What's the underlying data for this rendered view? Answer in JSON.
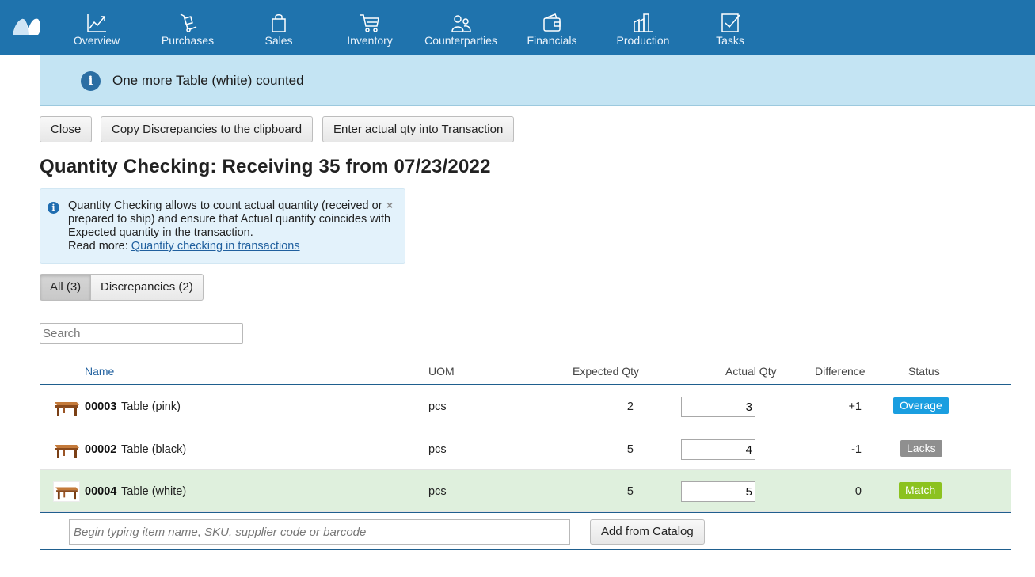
{
  "nav": {
    "items": [
      {
        "label": "Overview",
        "icon": "chart-line-icon"
      },
      {
        "label": "Purchases",
        "icon": "cart-dolly-icon"
      },
      {
        "label": "Sales",
        "icon": "shopping-bag-icon"
      },
      {
        "label": "Inventory",
        "icon": "cart-icon"
      },
      {
        "label": "Counterparties",
        "icon": "people-icon"
      },
      {
        "label": "Financials",
        "icon": "wallet-icon"
      },
      {
        "label": "Production",
        "icon": "factory-icon"
      },
      {
        "label": "Tasks",
        "icon": "checkbox-icon"
      }
    ],
    "background": "#1f73ad"
  },
  "notification": {
    "message": "One more Table (white) counted",
    "icon": "i",
    "background": "#c4e4f3"
  },
  "actions": {
    "close": "Close",
    "copy": "Copy Discrepancies to the clipboard",
    "enter": "Enter actual qty into Transaction"
  },
  "page_title": "Quantity Checking: Receiving 35 from 07/23/2022",
  "info": {
    "icon": "i",
    "text": "Quantity Checking allows to count actual quantity (received or prepared to ship) and ensure that Actual quantity coincides with Expected quantity in the transaction.",
    "read_more": "Read more:",
    "link": "Quantity checking in transactions",
    "close": "×"
  },
  "filters": {
    "all": "All (3)",
    "discrepancies": "Discrepancies (2)"
  },
  "search": {
    "placeholder": "Search"
  },
  "table": {
    "headers": {
      "name": "Name",
      "uom": "UOM",
      "expected": "Expected Qty",
      "actual": "Actual Qty",
      "difference": "Difference",
      "status": "Status"
    },
    "rows": [
      {
        "code": "00003",
        "name": "Table (pink)",
        "uom": "pcs",
        "expected": "2",
        "actual": "3",
        "difference": "+1",
        "status": "Overage",
        "status_color": "#1a9ee0"
      },
      {
        "code": "00002",
        "name": "Table (black)",
        "uom": "pcs",
        "expected": "5",
        "actual": "4",
        "difference": "-1",
        "status": "Lacks",
        "status_color": "#8f8f8f"
      },
      {
        "code": "00004",
        "name": "Table (white)",
        "uom": "pcs",
        "expected": "5",
        "actual": "5",
        "difference": "0",
        "status": "Match",
        "status_color": "#8cc21f"
      }
    ]
  },
  "add": {
    "placeholder": "Begin typing item name, SKU, supplier code or barcode",
    "button": "Add from Catalog"
  }
}
